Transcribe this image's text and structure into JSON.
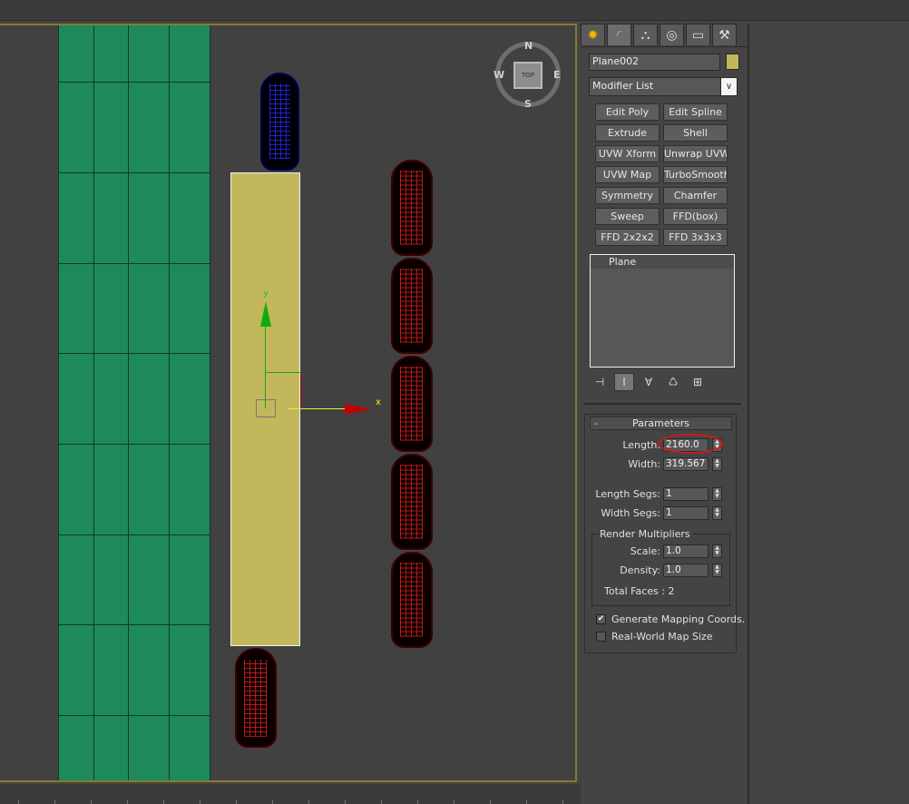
{
  "viewport": {
    "axis_y_label": "y",
    "axis_x_label": "x",
    "viewcube": {
      "face": "TOP",
      "n": "N",
      "s": "S",
      "e": "E",
      "w": "W"
    }
  },
  "tabs": [
    {
      "name": "create",
      "glyph": "✹"
    },
    {
      "name": "modify",
      "glyph": "◜"
    },
    {
      "name": "hierarchy",
      "glyph": "⛬"
    },
    {
      "name": "motion",
      "glyph": "◎"
    },
    {
      "name": "display",
      "glyph": "▭"
    },
    {
      "name": "utilities",
      "glyph": "⚒"
    }
  ],
  "object": {
    "name": "Plane002",
    "color": "#c3b75c"
  },
  "modifier_list": {
    "label": "Modifier List",
    "arrow": "∨"
  },
  "modifier_buttons": [
    "Edit Poly",
    "Edit Spline",
    "Extrude",
    "Shell",
    "UVW Xform",
    "Unwrap UVW",
    "UVW Map",
    "TurboSmooth",
    "Symmetry",
    "Chamfer",
    "Sweep",
    "FFD(box)",
    "FFD 2x2x2",
    "FFD 3x3x3"
  ],
  "stack": {
    "items": [
      "Plane"
    ]
  },
  "stack_tools": {
    "pin": "⊣",
    "show_end": "Ⅰ",
    "make_unique": "∀",
    "remove": "♺",
    "configure": "⊞"
  },
  "parameters": {
    "title": "Parameters",
    "collapse": "-",
    "length": {
      "label": "Length:",
      "value": "2160.0"
    },
    "width": {
      "label": "Width:",
      "value": "319.567"
    },
    "length_segs": {
      "label": "Length Segs:",
      "value": "1"
    },
    "width_segs": {
      "label": "Width Segs:",
      "value": "1"
    },
    "render_multipliers": {
      "title": "Render Multipliers",
      "scale": {
        "label": "Scale:",
        "value": "1.0"
      },
      "density": {
        "label": "Density:",
        "value": "1.0"
      },
      "total_faces": "Total Faces : 2"
    },
    "generate_mapping": {
      "label": "Generate Mapping Coords.",
      "checked": true,
      "mark": "✔"
    },
    "real_world": {
      "label": "Real-World Map Size",
      "checked": false
    }
  },
  "spinner_glyphs": {
    "up": "▲",
    "down": "▼"
  }
}
